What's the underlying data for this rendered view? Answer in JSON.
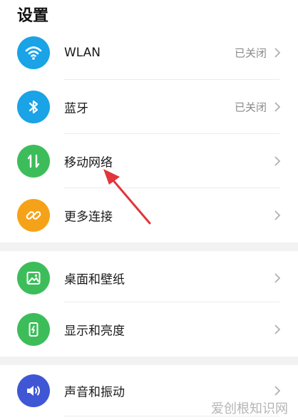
{
  "page_title": "设置",
  "items": [
    {
      "label": "WLAN",
      "status": "已关闭",
      "icon": "wifi-icon",
      "color": "#1aa3e6"
    },
    {
      "label": "蓝牙",
      "status": "已关闭",
      "icon": "bluetooth-icon",
      "color": "#1aa3e6"
    },
    {
      "label": "移动网络",
      "status": "",
      "icon": "mobile-data-icon",
      "color": "#3dbd5a"
    },
    {
      "label": "更多连接",
      "status": "",
      "icon": "link-icon",
      "color": "#f5a219"
    },
    {
      "label": "桌面和壁纸",
      "status": "",
      "icon": "image-icon",
      "color": "#3dbd5a"
    },
    {
      "label": "显示和亮度",
      "status": "",
      "icon": "display-brightness-icon",
      "color": "#3dbd5a"
    },
    {
      "label": "声音和振动",
      "status": "",
      "icon": "speaker-icon",
      "color": "#3f57d4"
    }
  ],
  "annotation_arrow_color": "#e0363c",
  "watermark": "爱创根知识网"
}
